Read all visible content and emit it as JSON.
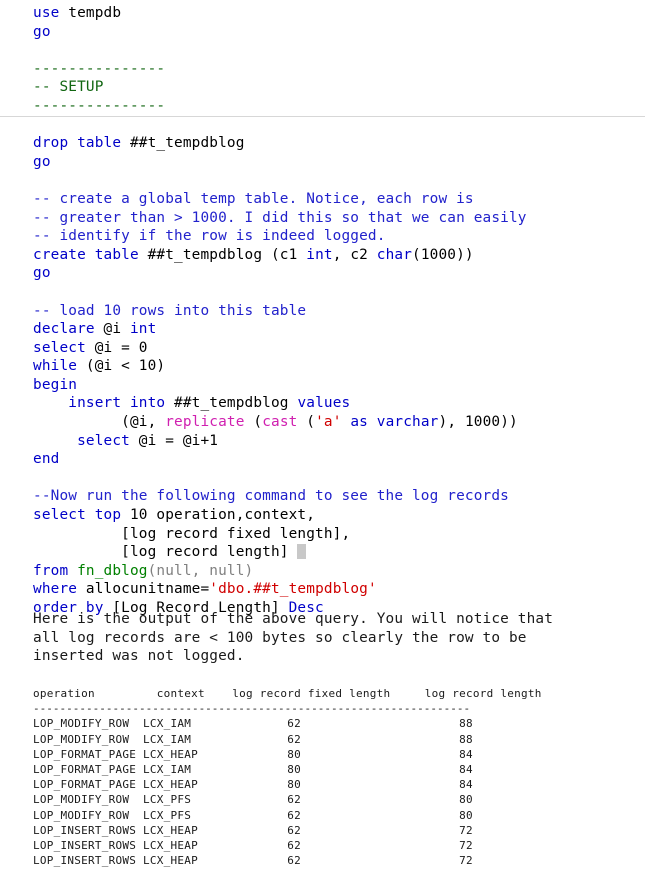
{
  "meta": {
    "language": "tsql",
    "colors": {
      "background": "#ffffff",
      "keyword": "#0000c8",
      "comment_blue": "#2222cc",
      "comment_green": "#116611",
      "function": "#008000",
      "builtin_magenta": "#d020b0",
      "string": "#d00000",
      "gray_literal": "#808080",
      "text": "#000000",
      "divider": "#d7d7d7",
      "cursor_block": "#c8c8c8"
    }
  },
  "code": {
    "lines": [
      {
        "id": "l1",
        "tokens": [
          {
            "t": "use",
            "c": "kw"
          },
          {
            "t": " tempdb",
            "c": "blk"
          }
        ]
      },
      {
        "id": "l2",
        "tokens": [
          {
            "t": "go",
            "c": "kw"
          }
        ]
      },
      {
        "id": "l3",
        "tokens": [
          {
            "t": "",
            "c": "blk"
          }
        ]
      },
      {
        "id": "l4",
        "tokens": [
          {
            "t": "---------------",
            "c": "cmt-green"
          }
        ]
      },
      {
        "id": "l5",
        "tokens": [
          {
            "t": "-- SETUP",
            "c": "cmt-green"
          }
        ]
      },
      {
        "id": "l6",
        "tokens": [
          {
            "t": "---------------",
            "c": "cmt-green"
          }
        ]
      },
      {
        "id": "l7",
        "tokens": [
          {
            "t": "",
            "c": "blk"
          }
        ]
      },
      {
        "id": "l8",
        "tokens": [
          {
            "t": "drop table",
            "c": "kw"
          },
          {
            "t": " ##t_tempdblog",
            "c": "blk"
          }
        ]
      },
      {
        "id": "l9",
        "tokens": [
          {
            "t": "go",
            "c": "kw"
          }
        ]
      },
      {
        "id": "l10",
        "tokens": [
          {
            "t": "",
            "c": "blk"
          }
        ]
      },
      {
        "id": "l11",
        "tokens": [
          {
            "t": "-- create a global temp table. Notice, each row is",
            "c": "cmt-blue"
          }
        ]
      },
      {
        "id": "l12",
        "tokens": [
          {
            "t": "-- greater than > 1000. I did this so that we can easily",
            "c": "cmt-blue"
          }
        ]
      },
      {
        "id": "l13",
        "tokens": [
          {
            "t": "-- identify if the row is indeed logged.",
            "c": "cmt-blue"
          }
        ]
      },
      {
        "id": "l14",
        "tokens": [
          {
            "t": "create table",
            "c": "kw"
          },
          {
            "t": " ##t_tempdblog (c1 ",
            "c": "blk"
          },
          {
            "t": "int",
            "c": "kw"
          },
          {
            "t": ", c2 ",
            "c": "blk"
          },
          {
            "t": "char",
            "c": "kw"
          },
          {
            "t": "(1000))",
            "c": "blk"
          }
        ]
      },
      {
        "id": "l15",
        "tokens": [
          {
            "t": "go",
            "c": "kw"
          }
        ]
      },
      {
        "id": "l16",
        "tokens": [
          {
            "t": "",
            "c": "blk"
          }
        ]
      },
      {
        "id": "l17",
        "tokens": [
          {
            "t": "-- load 10 rows into this table",
            "c": "cmt-blue"
          }
        ]
      },
      {
        "id": "l18",
        "tokens": [
          {
            "t": "declare",
            "c": "kw"
          },
          {
            "t": " @i ",
            "c": "blk"
          },
          {
            "t": "int",
            "c": "kw"
          }
        ]
      },
      {
        "id": "l19",
        "tokens": [
          {
            "t": "select",
            "c": "kw"
          },
          {
            "t": " @i = 0",
            "c": "blk"
          }
        ]
      },
      {
        "id": "l20",
        "tokens": [
          {
            "t": "while",
            "c": "kw"
          },
          {
            "t": " (@i < 10)",
            "c": "blk"
          }
        ]
      },
      {
        "id": "l21",
        "tokens": [
          {
            "t": "begin",
            "c": "kw"
          }
        ]
      },
      {
        "id": "l22",
        "tokens": [
          {
            "t": "    ",
            "c": "blk"
          },
          {
            "t": "insert into",
            "c": "kw"
          },
          {
            "t": " ##t_tempdblog ",
            "c": "blk"
          },
          {
            "t": "values",
            "c": "kw"
          }
        ]
      },
      {
        "id": "l23",
        "tokens": [
          {
            "t": "          (@i, ",
            "c": "blk"
          },
          {
            "t": "replicate",
            "c": "mag"
          },
          {
            "t": " (",
            "c": "blk"
          },
          {
            "t": "cast",
            "c": "mag"
          },
          {
            "t": " (",
            "c": "blk"
          },
          {
            "t": "'a'",
            "c": "str"
          },
          {
            "t": " as varchar",
            "c": "kw"
          },
          {
            "t": "), 1000))",
            "c": "blk"
          }
        ]
      },
      {
        "id": "l24",
        "tokens": [
          {
            "t": "     ",
            "c": "blk"
          },
          {
            "t": "select",
            "c": "kw"
          },
          {
            "t": " @i = @i+1",
            "c": "blk"
          }
        ]
      },
      {
        "id": "l25",
        "tokens": [
          {
            "t": "end",
            "c": "kw"
          }
        ]
      },
      {
        "id": "l26",
        "tokens": [
          {
            "t": "",
            "c": "blk"
          }
        ]
      },
      {
        "id": "l27",
        "tokens": [
          {
            "t": "--Now run the following command to see the log records",
            "c": "cmt-blue"
          }
        ]
      },
      {
        "id": "l28",
        "tokens": [
          {
            "t": "select top",
            "c": "kw"
          },
          {
            "t": " 10 operation,context,",
            "c": "blk"
          }
        ]
      },
      {
        "id": "l29",
        "tokens": [
          {
            "t": "          [log record fixed length],",
            "c": "blk"
          }
        ]
      },
      {
        "id": "l30",
        "tokens": [
          {
            "t": "          [log record length] ",
            "c": "blk"
          },
          {
            "t": "",
            "c": "cursor"
          }
        ]
      },
      {
        "id": "l31",
        "tokens": [
          {
            "t": "from",
            "c": "kw"
          },
          {
            "t": " ",
            "c": "blk"
          },
          {
            "t": "fn_dblog",
            "c": "fn"
          },
          {
            "t": "(null, null)",
            "c": "gray"
          }
        ]
      },
      {
        "id": "l32",
        "tokens": [
          {
            "t": "where",
            "c": "kw"
          },
          {
            "t": " allocunitname=",
            "c": "blk"
          },
          {
            "t": "'dbo.##t_tempdblog'",
            "c": "str"
          }
        ]
      },
      {
        "id": "l33",
        "tokens": [
          {
            "t": "order by",
            "c": "kw"
          },
          {
            "t": " [Log Record Length] ",
            "c": "blk"
          },
          {
            "t": "Desc",
            "c": "kw"
          }
        ]
      }
    ]
  },
  "prose": {
    "lines": [
      "Here is the output of the above query. You will notice that",
      "all log records are < 100 bytes so clearly the row to be",
      "inserted was not logged."
    ]
  },
  "results": {
    "headers": [
      "operation",
      "context",
      "log record fixed length",
      "log record length"
    ],
    "separator": "------------------------------------------------------------------",
    "rows": [
      {
        "operation": "LOP_MODIFY_ROW",
        "context": "LCX_IAM",
        "fixed_length": "62",
        "record_length": "88"
      },
      {
        "operation": "LOP_MODIFY_ROW",
        "context": "LCX_IAM",
        "fixed_length": "62",
        "record_length": "88"
      },
      {
        "operation": "LOP_FORMAT_PAGE",
        "context": "LCX_HEAP",
        "fixed_length": "80",
        "record_length": "84"
      },
      {
        "operation": "LOP_FORMAT_PAGE",
        "context": "LCX_IAM",
        "fixed_length": "80",
        "record_length": "84"
      },
      {
        "operation": "LOP_FORMAT_PAGE",
        "context": "LCX_HEAP",
        "fixed_length": "80",
        "record_length": "84"
      },
      {
        "operation": "LOP_MODIFY_ROW",
        "context": "LCX_PFS",
        "fixed_length": "62",
        "record_length": "80"
      },
      {
        "operation": "LOP_MODIFY_ROW",
        "context": "LCX_PFS",
        "fixed_length": "62",
        "record_length": "80"
      },
      {
        "operation": "LOP_INSERT_ROWS",
        "context": "LCX_HEAP",
        "fixed_length": "62",
        "record_length": "72"
      },
      {
        "operation": "LOP_INSERT_ROWS",
        "context": "LCX_HEAP",
        "fixed_length": "62",
        "record_length": "72"
      },
      {
        "operation": "LOP_INSERT_ROWS",
        "context": "LCX_HEAP",
        "fixed_length": "62",
        "record_length": "72"
      }
    ]
  }
}
